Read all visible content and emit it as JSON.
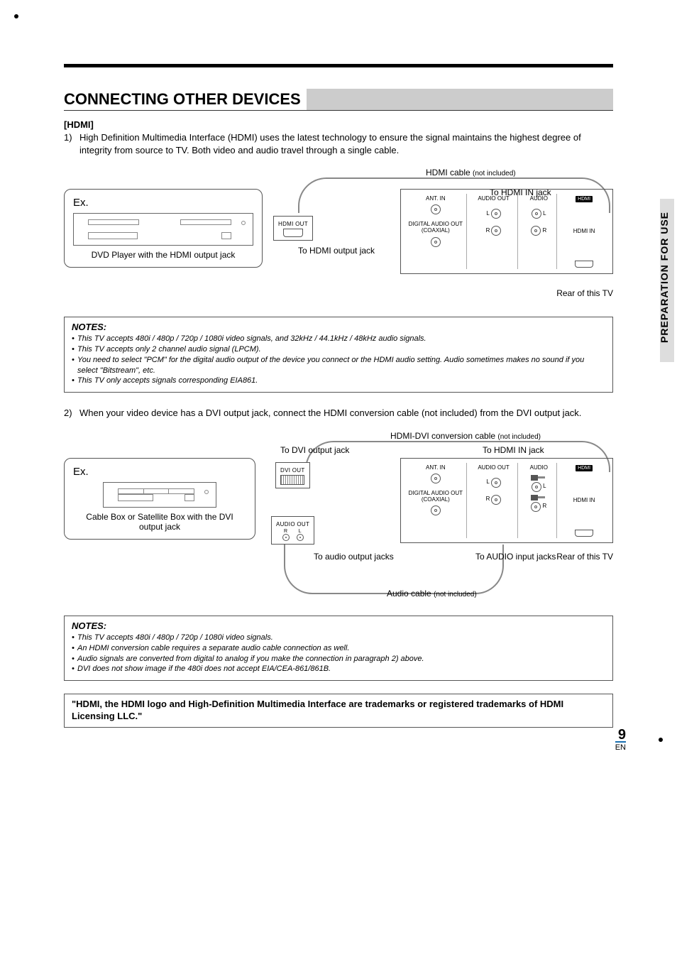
{
  "side_tab": "PREPARATION FOR USE",
  "section_title": "CONNECTING OTHER DEVICES",
  "hdmi_heading": "[HDMI]",
  "para1_num": "1)",
  "para1": "High Definition Multimedia Interface (HDMI) uses the latest technology to ensure the signal maintains the highest degree of integrity from source to TV. Both video and audio travel through a single cable.",
  "diagram1": {
    "hdmi_cable": "HDMI cable",
    "not_included": "(not included)",
    "to_hdmi_in": "To HDMI IN jack",
    "to_hdmi_out": "To HDMI output jack",
    "ex": "Ex.",
    "dvd_caption": "DVD Player with the HDMI output jack",
    "hdmi_out_lbl": "HDMI OUT",
    "rear": "Rear of this TV",
    "tv": {
      "ant_in": "ANT. IN",
      "digital_audio": "DIGITAL AUDIO OUT (COAXIAL)",
      "audio_out": "AUDIO OUT",
      "l": "L",
      "r": "R",
      "audio": "AUDIO",
      "hdmi": "HDMI",
      "hdmi_in": "HDMI IN"
    }
  },
  "notes1": {
    "heading": "NOTES:",
    "items": [
      "This TV accepts 480i / 480p / 720p / 1080i video signals, and 32kHz / 44.1kHz / 48kHz audio signals.",
      "This TV accepts only 2 channel audio signal (LPCM).",
      "You need to select \"PCM\" for the digital audio output of the device you connect or the HDMI audio setting.  Audio sometimes makes no sound if you select \"Bitstream\", etc.",
      "This TV only accepts signals corresponding EIA861."
    ]
  },
  "para2_num": "2)",
  "para2": "When your video device has a DVI output jack, connect the HDMI conversion cable (not included) from the DVI output jack.",
  "diagram2": {
    "conv_cable": "HDMI-DVI conversion cable",
    "not_included": "(not included)",
    "to_dvi_out": "To DVI output jack",
    "to_hdmi_in": "To HDMI IN jack",
    "ex": "Ex.",
    "cable_caption": "Cable Box or Satellite Box with the DVI output jack",
    "dvi_out_lbl": "DVI OUT",
    "audio_out_lbl": "AUDIO OUT",
    "r": "R",
    "l": "L",
    "to_audio_out": "To audio output jacks",
    "to_audio_in": "To AUDIO input jacks",
    "audio_cable": "Audio cable",
    "rear": "Rear of this TV"
  },
  "notes2": {
    "heading": "NOTES:",
    "items": [
      "This TV accepts 480i / 480p / 720p / 1080i video signals.",
      "An HDMI conversion cable requires a separate audio cable connection as well.",
      "Audio signals are converted from digital to analog if you make the connection in paragraph 2) above.",
      "DVI does not show image if the 480i does not accept EIA/CEA-861/861B."
    ]
  },
  "trademark": "\"HDMI, the HDMI logo and High-Definition Multimedia Interface are trademarks or registered trademarks of HDMI Licensing LLC.\"",
  "page_number": "9",
  "lang": "EN"
}
